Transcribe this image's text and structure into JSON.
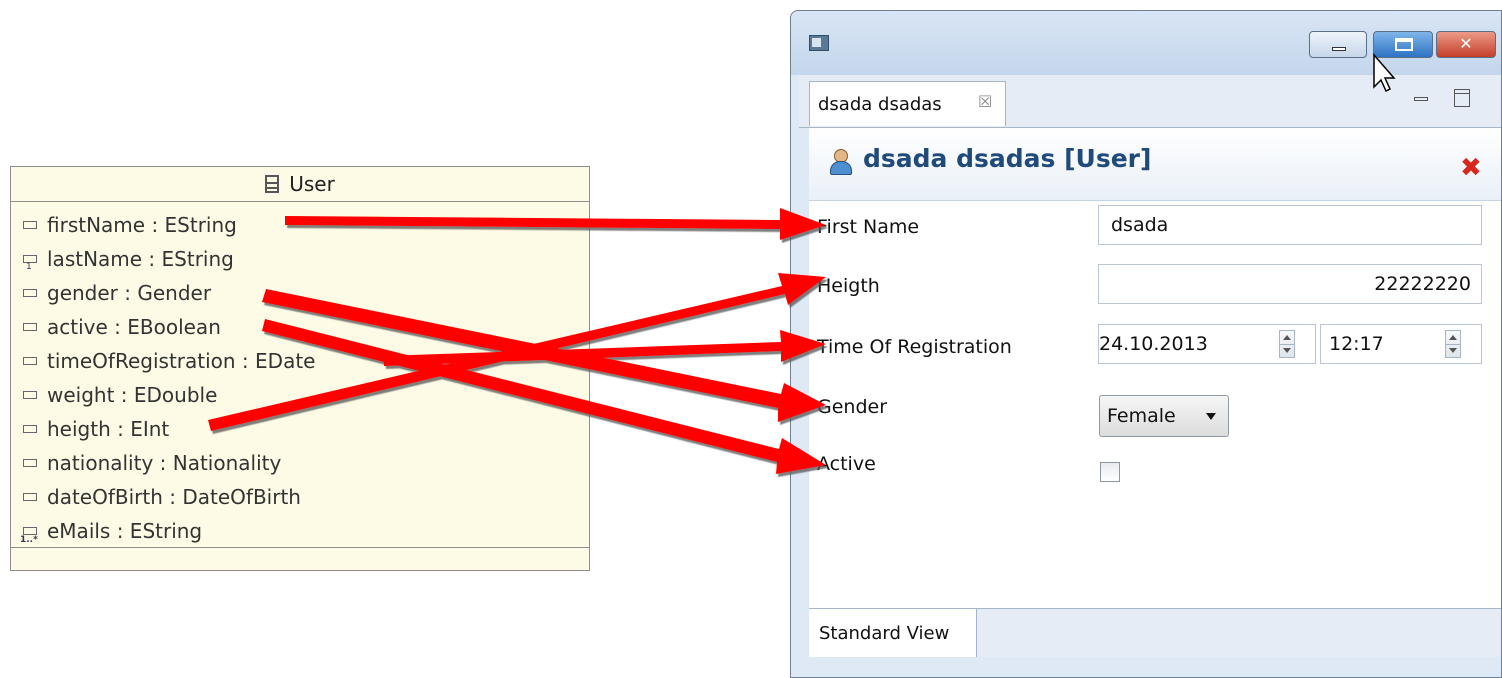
{
  "uml": {
    "class_name": "User",
    "attributes": [
      {
        "label": "firstName : EString",
        "icon": "attribute-icon"
      },
      {
        "label": "lastName : EString",
        "icon": "id-attribute-icon"
      },
      {
        "label": "gender : Gender",
        "icon": "attribute-icon"
      },
      {
        "label": "active : EBoolean",
        "icon": "attribute-icon"
      },
      {
        "label": "timeOfRegistration : EDate",
        "icon": "attribute-icon"
      },
      {
        "label": "weight : EDouble",
        "icon": "attribute-icon"
      },
      {
        "label": "heigth : EInt",
        "icon": "attribute-icon"
      },
      {
        "label": "nationality : Nationality",
        "icon": "attribute-icon"
      },
      {
        "label": "dateOfBirth : DateOfBirth",
        "icon": "attribute-icon"
      },
      {
        "label": "eMails : EString",
        "icon": "multi-attribute-icon"
      }
    ]
  },
  "window": {
    "tab_title": "dsada dsadas",
    "editor_title": "dsada dsadas [User]",
    "fields": {
      "first_name": {
        "label": "First Name",
        "value": "dsada"
      },
      "heigth": {
        "label": "Heigth",
        "value": "22222220"
      },
      "time_of_registration": {
        "label": "Time Of Registration",
        "date": "24.10.2013",
        "time": "12:17"
      },
      "gender": {
        "label": "Gender",
        "value": "Female"
      },
      "active": {
        "label": "Active",
        "checked": false
      }
    },
    "bottom_tab": "Standard View"
  },
  "colors": {
    "arrow": "#ff0000",
    "uml_background": "#fdfbe6",
    "title_blue": "#1f4a79",
    "delete_red": "#d9261c"
  }
}
